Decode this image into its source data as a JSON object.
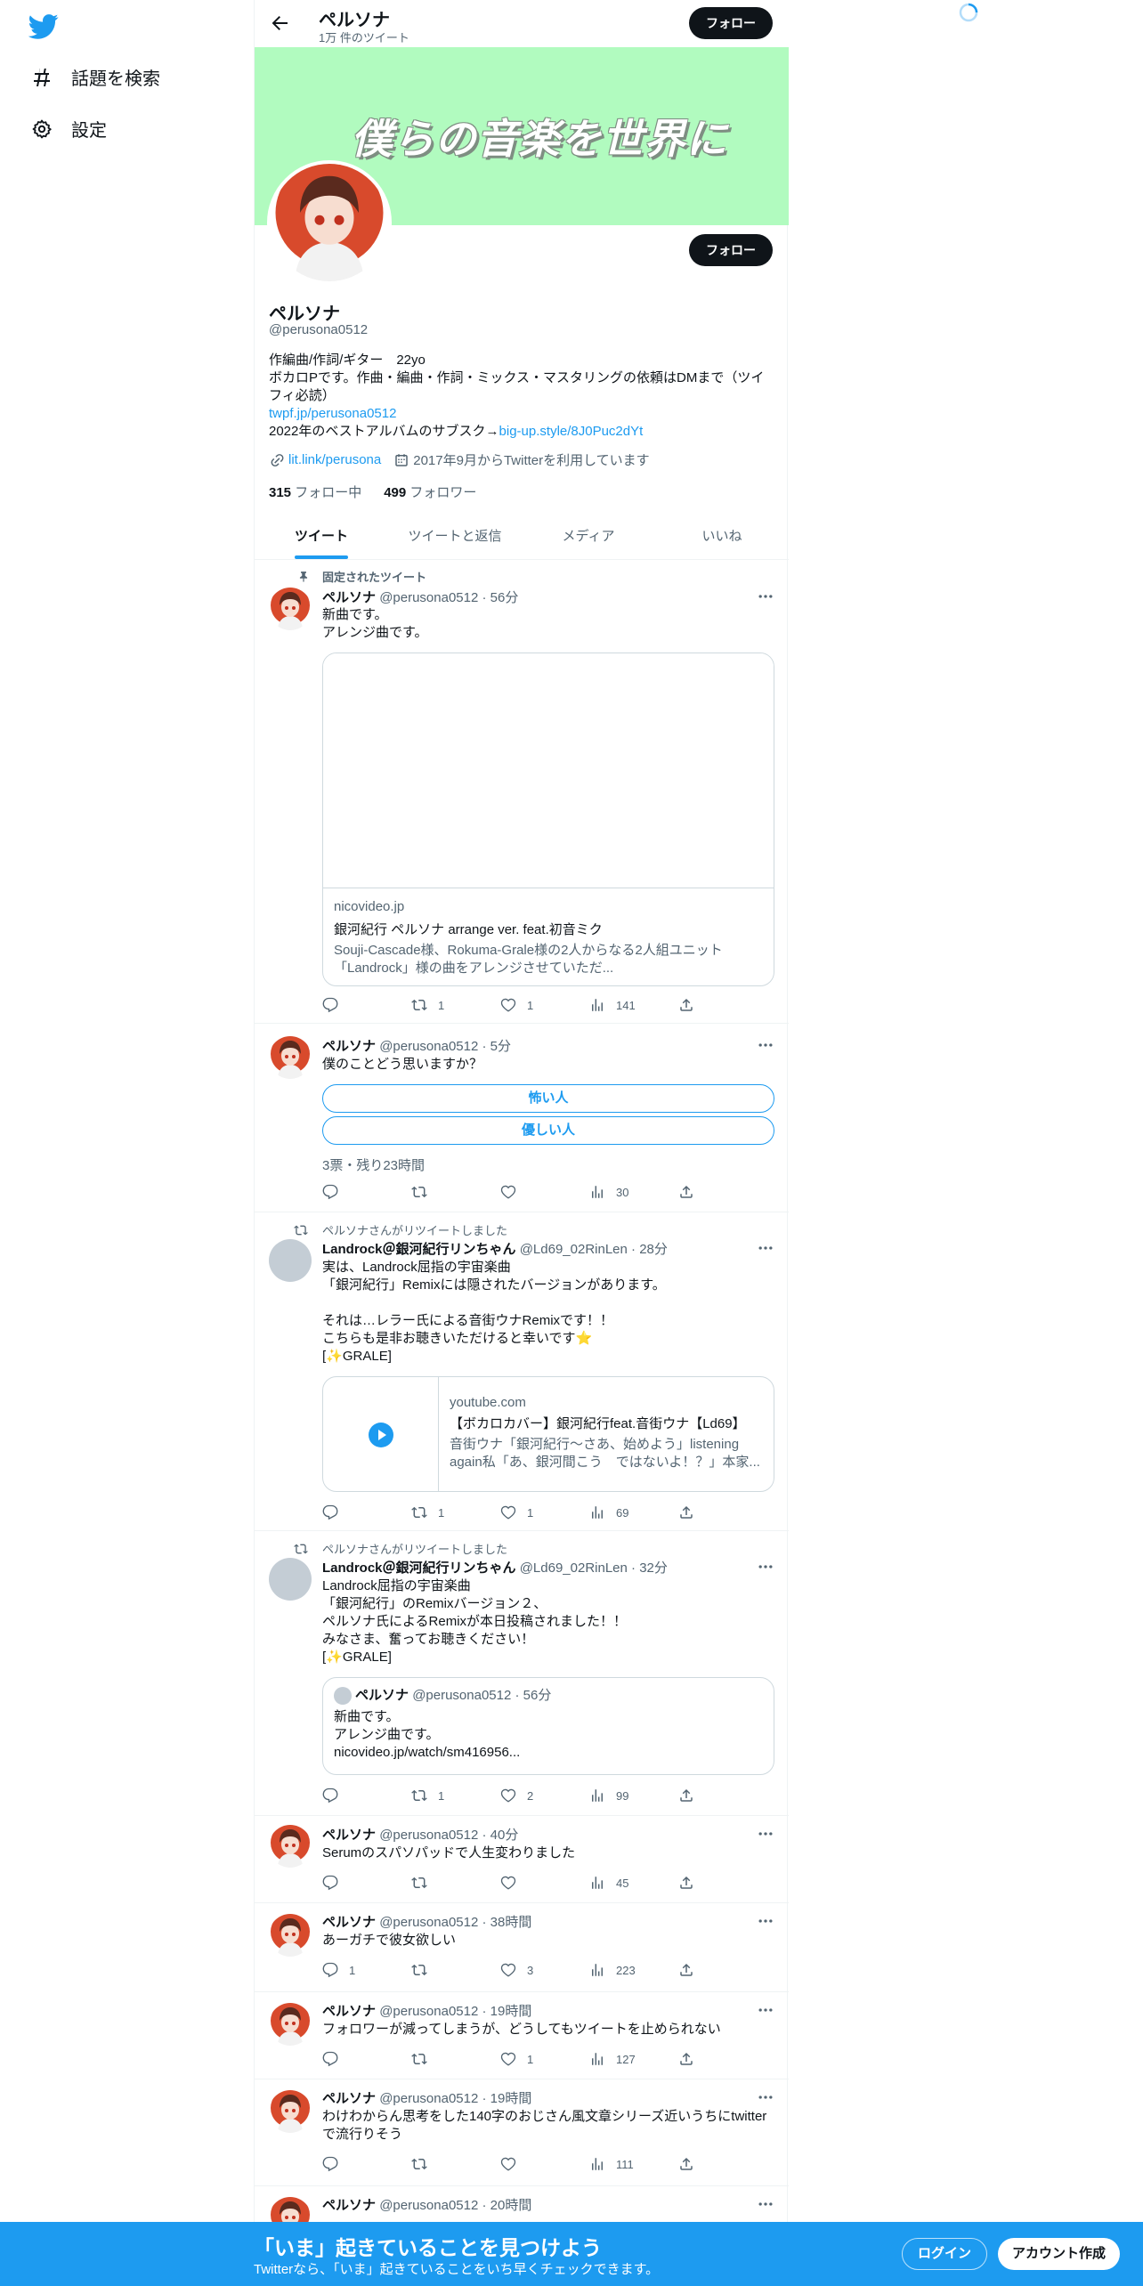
{
  "sidebar": {
    "items": [
      {
        "label": "話題を検索",
        "icon": "hashtag-icon"
      },
      {
        "label": "設定",
        "icon": "gear-icon"
      }
    ]
  },
  "header": {
    "name": "ペルソナ",
    "tweet_count": "1万 件のツイート",
    "follow_label": "フォロー"
  },
  "banner": {
    "text": "僕らの音楽を世界に",
    "color": "#b1fbbf"
  },
  "profile": {
    "name": "ペルソナ",
    "handle": "@perusona0512",
    "follow_label": "フォロー",
    "bio_line1": "作編曲/作詞/ギター　22yo",
    "bio_line2": "ボカロPです。作曲・編曲・作詞・ミックス・マスタリングの依頼はDMまで（ツイフィ必読）",
    "bio_link1": "twpf.jp/perusona0512",
    "bio_line4_prefix": "2022年のベストアルバムのサブスク→",
    "bio_link2": "big-up.style/8J0Puc2dYt",
    "website": "lit.link/perusona",
    "joined": "2017年9月からTwitterを利用しています",
    "following_count": "315",
    "following_label": " フォロー中",
    "followers_count": "499",
    "followers_label": " フォロワー"
  },
  "tabs": [
    "ツイート",
    "ツイートと返信",
    "メディア",
    "いいね"
  ],
  "tweets": [
    {
      "social": "固定されたツイート",
      "name": "ペルソナ",
      "handle": "@perusona0512 · 56分",
      "text": "新曲です。\nアレンジ曲です。",
      "card": {
        "domain": "nicovideo.jp",
        "title": "銀河紀行 ペルソナ arrange ver. feat.初音ミク",
        "desc": "Souji-Cascade様、Rokuma-Grale様の2人からなる2人組ユニット「Landrock」様の曲をアレンジさせていただ..."
      },
      "reply": "",
      "retweet": "1",
      "like": "1",
      "views": "141"
    },
    {
      "name": "ペルソナ",
      "handle": "@perusona0512 · 5分",
      "text": "僕のことどう思いますか？",
      "poll": [
        "怖い人",
        "優しい人"
      ],
      "poll_meta": "3票・残り23時間",
      "reply": "",
      "retweet": "",
      "like": "",
      "views": "30"
    },
    {
      "social": "ペルソナさんがリツイートしました",
      "name": "Landrock＠銀河紀行リンちゃん",
      "handle": "@Ld69_02RinLen · 28分",
      "text": "実は、Landrock屈指の宇宙楽曲\n「銀河紀行」Remixには隠されたバージョンがあります。\n\nそれは…レラー氏による音街ウナRemixです！！\nこちらも是非お聴きいただけると幸いです⭐️\n[✨GRALE]",
      "card": {
        "domain": "youtube.com",
        "title": "【ボカロカバー】銀河紀行feat.音街ウナ【Ld69】",
        "desc": "音街ウナ「銀河紀行〜さあ、始めよう」listening again私「あ、銀河間こう　ではないよ！？」本家..."
      },
      "reply": "",
      "retweet": "1",
      "like": "1",
      "views": "69"
    },
    {
      "social": "ペルソナさんがリツイートしました",
      "name": "Landrock＠銀河紀行リンちゃん",
      "handle": "@Ld69_02RinLen · 32分",
      "text": "Landrock屈指の宇宙楽曲\n「銀河紀行」のRemixバージョン２、\nペルソナ氏によるRemixが本日投稿されました！！\nみなさま、奮ってお聴きください！\n[✨GRALE]",
      "quote": {
        "name": "ペルソナ",
        "handle": "@perusona0512 · 56分",
        "text": "新曲です。\nアレンジ曲です。\nnicovideo.jp/watch/sm416956..."
      },
      "reply": "",
      "retweet": "1",
      "like": "2",
      "views": "99"
    },
    {
      "name": "ペルソナ",
      "handle": "@perusona0512 · 40分",
      "text": "Serumのスパソパッドで人生変わりました",
      "reply": "",
      "retweet": "",
      "like": "",
      "views": "45"
    },
    {
      "name": "ペルソナ",
      "handle": "@perusona0512 · 38時間",
      "text": "あーガチで彼女欲しい",
      "reply": "1",
      "retweet": "",
      "like": "3",
      "views": "223"
    },
    {
      "name": "ペルソナ",
      "handle": "@perusona0512 · 19時間",
      "text": "フォロワーが減ってしまうが、どうしてもツイートを止められない",
      "reply": "",
      "retweet": "",
      "like": "1",
      "views": "127"
    },
    {
      "name": "ペルソナ",
      "handle": "@perusona0512 · 19時間",
      "text": "わけわからん思考をした140字のおじさん風文章シリーズ近いうちにtwitterで流行りそう",
      "reply": "",
      "retweet": "",
      "like": "",
      "views": "111"
    },
    {
      "name": "ペルソナ",
      "handle": "@perusona0512 · 20時間"
    }
  ],
  "bottom_bar": {
    "title": "「いま」起きていることを見つけよう",
    "subtitle": "Twitterなら、「いま」起きていることをいち早くチェックできます。",
    "login": "ログイン",
    "signup": "アカウント作成"
  },
  "colors": {
    "accent": "#1d9bf0",
    "text": "#0f1419",
    "muted": "#536471"
  }
}
